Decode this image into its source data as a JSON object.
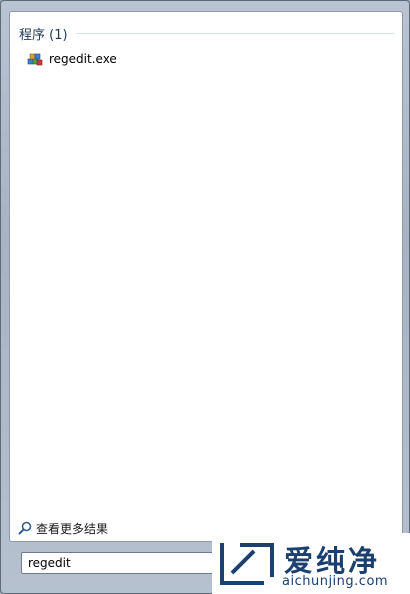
{
  "results": {
    "group_title": "程序 (1)",
    "items": [
      {
        "label": "regedit.exe",
        "icon": "regedit-icon"
      }
    ],
    "see_more": "查看更多结果"
  },
  "search": {
    "value": "regedit"
  },
  "watermark": {
    "cn": "爱纯净",
    "en": "aichunjing.com",
    "color": "#1b3f6e"
  },
  "colors": {
    "header": "#1e395b",
    "frame": "#a7b3c2"
  }
}
